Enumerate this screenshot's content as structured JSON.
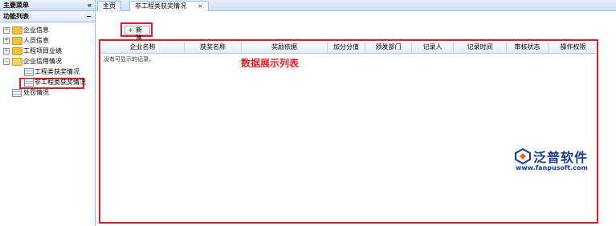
{
  "sidebar": {
    "title": "主要菜单",
    "collapse_glyph": "«",
    "section_title": "功能列表",
    "section_glyph": "−",
    "items": [
      {
        "label": "企业信息",
        "expander": "+",
        "icon": "folder-icon"
      },
      {
        "label": "人员信息",
        "expander": "+",
        "icon": "folder-icon"
      },
      {
        "label": "工程项目业绩",
        "expander": "+",
        "icon": "folder-icon"
      },
      {
        "label": "企业信用情况",
        "expander": "−",
        "icon": "folder-open-icon"
      },
      {
        "label": "工程类获奖情况",
        "icon": "grid-icon"
      },
      {
        "label": "非工程类获奖情况",
        "icon": "grid-icon",
        "selected": true
      },
      {
        "label": "处罚情况",
        "icon": "grid-icon"
      }
    ]
  },
  "tabs": [
    {
      "label": "主页"
    },
    {
      "label": "非工程类获奖情况",
      "close": "×",
      "active": true
    }
  ],
  "toolbar": {
    "new_plus": "+",
    "new_label": "新 建"
  },
  "table": {
    "columns": [
      "企业名称",
      "获奖名称",
      "奖励依据",
      "加分分值",
      "颁发部门",
      "记录人",
      "记录时间",
      "审核状态",
      "操作权限"
    ],
    "empty_text": "没有可显示的记录。"
  },
  "annotation": "数据展示列表",
  "watermark": {
    "brand": "泛普软件",
    "url": "www.fanpusoft.com"
  },
  "colors": {
    "highlight": "#d0202a",
    "header_bg": "#cddff5",
    "border": "#99bbe8",
    "brand": "#1a3a8a"
  }
}
